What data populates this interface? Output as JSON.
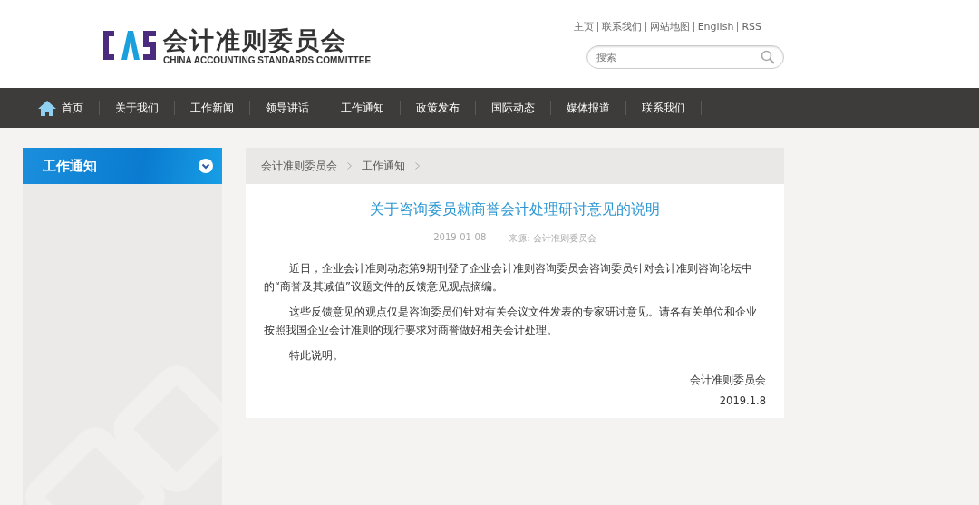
{
  "header": {
    "logo_title": "会计准则委员会",
    "logo_subtitle": "CHINA ACCOUNTING STANDARDS COMMITTEE",
    "top_links": [
      "主页",
      "联系我们",
      "网站地图",
      "English",
      "RSS"
    ],
    "search": {
      "placeholder": "搜索"
    }
  },
  "nav": {
    "items": [
      {
        "label": "首页",
        "kind": "home"
      },
      {
        "label": "关于我们",
        "kind": "text"
      },
      {
        "label": "工作新闻",
        "kind": "text"
      },
      {
        "label": "领导讲话",
        "kind": "text"
      },
      {
        "label": "工作通知",
        "kind": "text"
      },
      {
        "label": "政策发布",
        "kind": "text"
      },
      {
        "label": "国际动态",
        "kind": "text"
      },
      {
        "label": "媒体报道",
        "kind": "text"
      },
      {
        "label": "联系我们",
        "kind": "text"
      }
    ]
  },
  "sidebar": {
    "title": "工作通知",
    "expanded": true
  },
  "breadcrumb": [
    "会计准则委员会",
    "工作通知"
  ],
  "article": {
    "title": "关于咨询委员就商誉会计处理研讨意见的说明",
    "date": "2019-01-08",
    "source": "来源: 会计准则委员会",
    "paragraphs": [
      "近日，企业会计准则动态第9期刊登了企业会计准则咨询委员会咨询委员针对会计准则咨询论坛中的“商誉及其减值”议题文件的反馈意见观点摘编。",
      "这些反馈意见的观点仅是咨询委员们针对有关会议文件发表的专家研讨意见。请各有关单位和企业按照我国企业会计准则的现行要求对商誉做好相关会计处理。",
      "特此说明。"
    ],
    "signature": "会计准则委员会",
    "sign_date": "2019.1.8"
  }
}
